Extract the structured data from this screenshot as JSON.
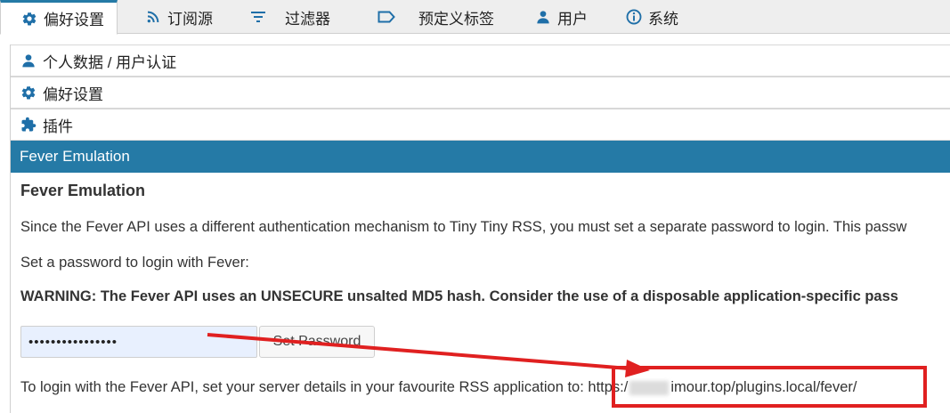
{
  "tabs": [
    {
      "label": "偏好设置",
      "icon": "gear-icon",
      "active": true
    },
    {
      "label": "订阅源",
      "icon": "rss-icon",
      "active": false
    },
    {
      "label": "过滤器",
      "icon": "filter-icon",
      "active": false
    },
    {
      "label": "预定义标签",
      "icon": "label-icon",
      "active": false
    },
    {
      "label": "用户",
      "icon": "user-icon",
      "active": false
    },
    {
      "label": "系统",
      "icon": "info-icon",
      "active": false
    }
  ],
  "accordion": {
    "personal": {
      "label": "个人数据 / 用户认证",
      "icon": "user-icon"
    },
    "preferences": {
      "label": "偏好设置",
      "icon": "gear-icon"
    },
    "plugins": {
      "label": "插件",
      "icon": "puzzle-icon"
    },
    "fever": {
      "label": "Fever Emulation"
    }
  },
  "fever": {
    "title": "Fever Emulation",
    "description": "Since the Fever API uses a different authentication mechanism to Tiny Tiny RSS, you must set a separate password to login. This passw",
    "set_prompt": "Set a password to login with Fever:",
    "warning": "WARNING: The Fever API uses an UNSECURE unsalted MD5 hash. Consider the use of a disposable application-specific pass",
    "password_value": "••••••••••••••••",
    "set_button": "Set Password",
    "login_info": "To login with the Fever API, set your server details in your favourite RSS application to:",
    "url_prefix": "https:/",
    "url_suffix": "imour.top/plugins.local/fever/"
  },
  "colors": {
    "accent": "#257aa6",
    "annotation": "#e02020"
  }
}
